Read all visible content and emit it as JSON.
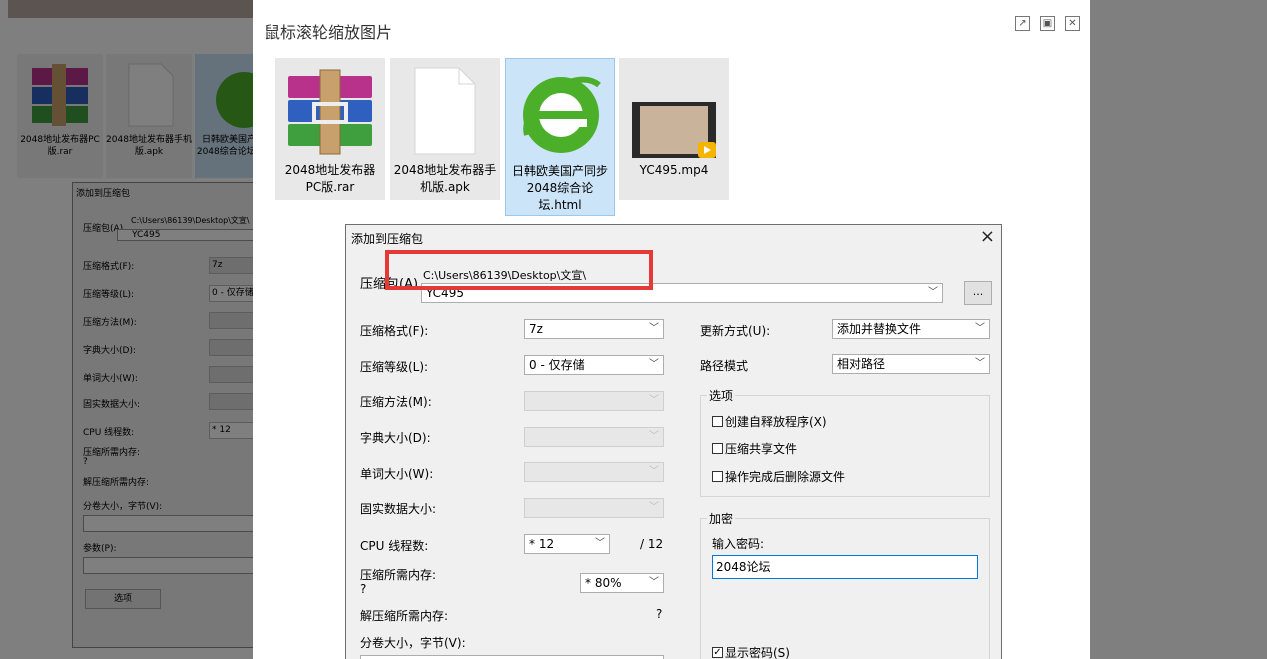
{
  "viewer": {
    "title": "鼠标滚轮缩放图片",
    "files": [
      {
        "name": "2048地址发布器PC版.rar"
      },
      {
        "name": "2048地址发布器手机版.apk"
      },
      {
        "name": "日韩欧美国产同步 2048综合论坛.html"
      },
      {
        "name": "YC495.mp4"
      }
    ]
  },
  "background": {
    "files": [
      "2048地址发布器PC版.rar",
      "2048地址发布器手机版.apk",
      "日韩欧美国产同步 2048综合论坛.html"
    ],
    "dialog_title": "添加到压缩包",
    "path": "C:\\Users\\86139\\Desktop\\文宣\\",
    "name": "YC495",
    "rows": [
      "压缩包(A)",
      "压缩格式(F):",
      "压缩等级(L):",
      "压缩方法(M):",
      "字典大小(D):",
      "单词大小(W):",
      "固实数据大小:",
      "CPU 线程数:",
      "压缩所需内存:",
      "解压缩所需内存:",
      "分卷大小，字节(V):",
      "参数(P):"
    ],
    "values": {
      "format": "7z",
      "level": "0 - 仅存储",
      "threads": "* 12",
      "mem": "?"
    },
    "options_button": "选项"
  },
  "dialog": {
    "title": "添加到压缩包",
    "close": "×",
    "archive_label": "压缩包(A)",
    "path": "C:\\Users\\86139\\Desktop\\文宣\\",
    "archive_name": "YC495",
    "browse": "...",
    "format_label": "压缩格式(F):",
    "format_value": "7z",
    "level_label": "压缩等级(L):",
    "level_value": "0 - 仅存储",
    "method_label": "压缩方法(M):",
    "dict_label": "字典大小(D):",
    "word_label": "单词大小(W):",
    "solid_label": "固实数据大小:",
    "cpu_label": "CPU 线程数:",
    "cpu_value": "* 12",
    "cpu_total": "/ 12",
    "mem_label": "压缩所需内存:",
    "mem_value": "?",
    "mem_pct": "* 80%",
    "unmem_label": "解压缩所需内存:",
    "unmem_value": "?",
    "split_label": "分卷大小，字节(V):",
    "update_label": "更新方式(U):",
    "update_value": "添加并替换文件",
    "path_mode_label": "路径模式",
    "path_mode_value": "相对路径",
    "options_group": "选项",
    "opt_sfx": "创建自释放程序(X)",
    "opt_shared": "压缩共享文件",
    "opt_delete": "操作完成后删除源文件",
    "encrypt_group": "加密",
    "pwd_label": "输入密码:",
    "pwd_value": "2048论坛",
    "show_pwd": "显示密码(S)"
  },
  "colors": {
    "highlight": "#e53935",
    "selection": "#cce4f7",
    "focus": "#0078d7"
  }
}
